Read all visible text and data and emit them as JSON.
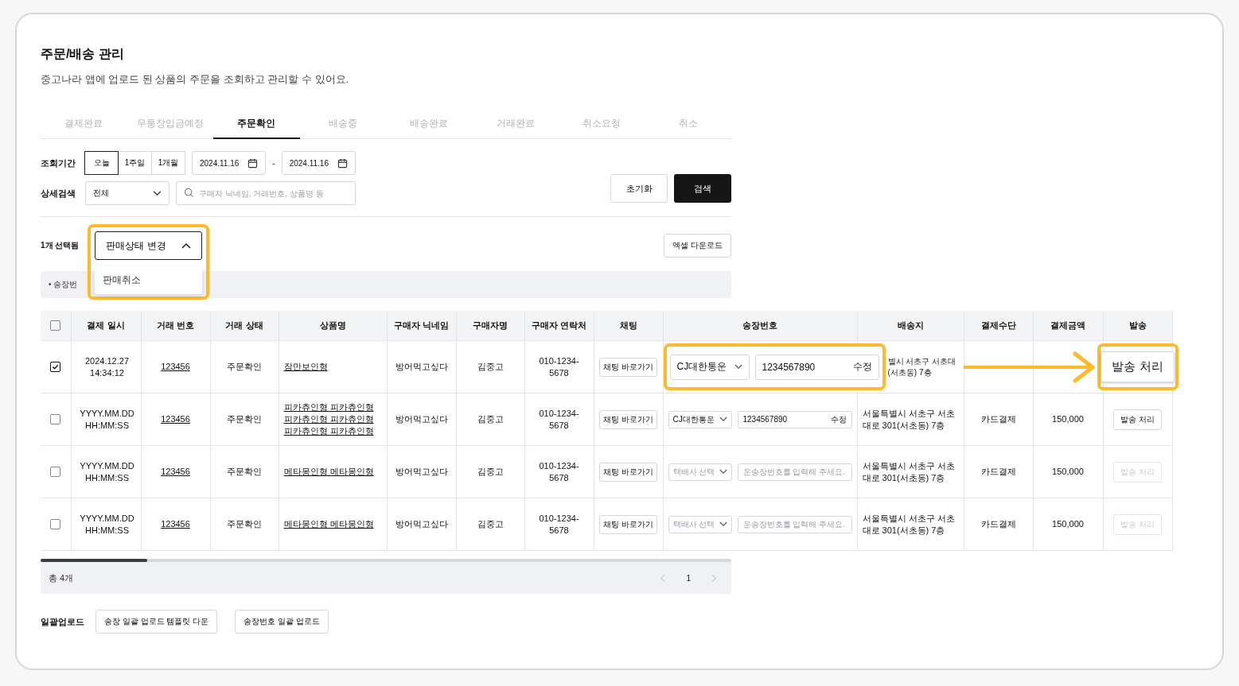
{
  "page": {
    "title": "주문/배송 관리",
    "description": "중고나라 앱에 업로드 된 상품의 주문을 조회하고 관리할 수 있어요."
  },
  "tabs": [
    {
      "label": "결제완료",
      "selected": false
    },
    {
      "label": "무통장입금예정",
      "selected": false
    },
    {
      "label": "주문확인",
      "selected": true
    },
    {
      "label": "배송중",
      "selected": false
    },
    {
      "label": "배송완료",
      "selected": false
    },
    {
      "label": "거래완료",
      "selected": false
    },
    {
      "label": "취소요청",
      "selected": false
    },
    {
      "label": "취소",
      "selected": false
    }
  ],
  "filters": {
    "period_label": "조회기간",
    "period_options": [
      {
        "label": "오늘",
        "selected": true
      },
      {
        "label": "1주일",
        "selected": false
      },
      {
        "label": "1개월",
        "selected": false
      }
    ],
    "date_from": "2024.11.16",
    "date_separator": "-",
    "date_to": "2024.11.16",
    "search_label": "상세검색",
    "search_scope": "전체",
    "search_placeholder": "구매자 닉네임, 거래번호, 상품명 등",
    "reset_button": "초기화",
    "search_button": "검색"
  },
  "selection": {
    "count_label": "1개 선택됨",
    "status_dropdown": {
      "label": "판매상태 변경",
      "expanded": true,
      "highlighted": true,
      "options": [
        "판매취소"
      ]
    },
    "excel_button": "엑셀 다운로드",
    "notice": "• 송장번"
  },
  "table": {
    "select_all_checked": false,
    "columns": [
      "결제 일시",
      "거래 번호",
      "거래 상태",
      "상품명",
      "구매자 닉네임",
      "구매자명",
      "구매자 연락처",
      "채팅",
      "송장번호",
      "배송지",
      "결제수단",
      "결제금액",
      "발송"
    ],
    "rows": [
      {
        "checked": true,
        "highlighted": true,
        "datetime": "2024.12.27 14:34:12",
        "deal_no": "123456",
        "status": "주문확인",
        "product": "잠만보인형",
        "nickname": "방어먹고싶다",
        "buyer": "김중고",
        "phone": "010-1234-5678",
        "chat_button": "채팅 바로가기",
        "invoice": {
          "courier": "CJ대한통운",
          "number": "1234567890",
          "edit": "수정"
        },
        "address": "별시 서초구 서초대 (서초동) 7층",
        "ship_button": {
          "label": "발송 처리",
          "disabled": false
        }
      },
      {
        "checked": false,
        "highlighted": false,
        "datetime": "YYYY.MM.DD HH:MM:SS",
        "deal_no": "123456",
        "status": "주문확인",
        "product": "피카츄인형 피카츄인형 피카츄인형 피카츄인형 피카츄인형 피카츄인형",
        "nickname": "방어먹고싶다",
        "buyer": "김중고",
        "phone": "010-1234-5678",
        "chat_button": "채팅 바로가기",
        "invoice": {
          "courier": "CJ대한통운",
          "number": "1234567890",
          "edit": "수정"
        },
        "address": "서울특별시 서초구 서초대로 301(서초동) 7층",
        "payment": "카드결제",
        "amount": "150,000",
        "ship_button": {
          "label": "발송 처리",
          "disabled": false
        }
      },
      {
        "checked": false,
        "highlighted": false,
        "datetime": "YYYY.MM.DD HH:MM:SS",
        "deal_no": "123456",
        "status": "주문확인",
        "product": "메타몽인형 메타몽인형",
        "nickname": "방어먹고싶다",
        "buyer": "김중고",
        "phone": "010-1234-5678",
        "chat_button": "채팅 바로가기",
        "invoice": {
          "courier_placeholder": "택배사 선택",
          "number_placeholder": "운송장번호를 입력해 주세요."
        },
        "address": "서울특별시 서초구 서초대로 301(서초동) 7층",
        "payment": "카드결제",
        "amount": "150,000",
        "ship_button": {
          "label": "발송 처리",
          "disabled": true
        }
      },
      {
        "checked": false,
        "highlighted": false,
        "datetime": "YYYY.MM.DD HH:MM:SS",
        "deal_no": "123456",
        "status": "주문확인",
        "product": "메타몽인형 메타몽인형",
        "nickname": "방어먹고싶다",
        "buyer": "김중고",
        "phone": "010-1234-5678",
        "chat_button": "채팅 바로가기",
        "invoice": {
          "courier_placeholder": "택배사 선택",
          "number_placeholder": "운송장번호를 입력해 주세요."
        },
        "address": "서울특별시 서초구 서초대로 301(서초동) 7층",
        "payment": "카드결제",
        "amount": "150,000",
        "ship_button": {
          "label": "발송 처리",
          "disabled": true
        }
      }
    ]
  },
  "footer": {
    "total": "총 4개",
    "page": "1"
  },
  "bulk_upload": {
    "label": "일괄업로드",
    "buttons": [
      "송장 일괄 업로드 템플릿 다운",
      "송장번호 일괄 업로드"
    ]
  }
}
